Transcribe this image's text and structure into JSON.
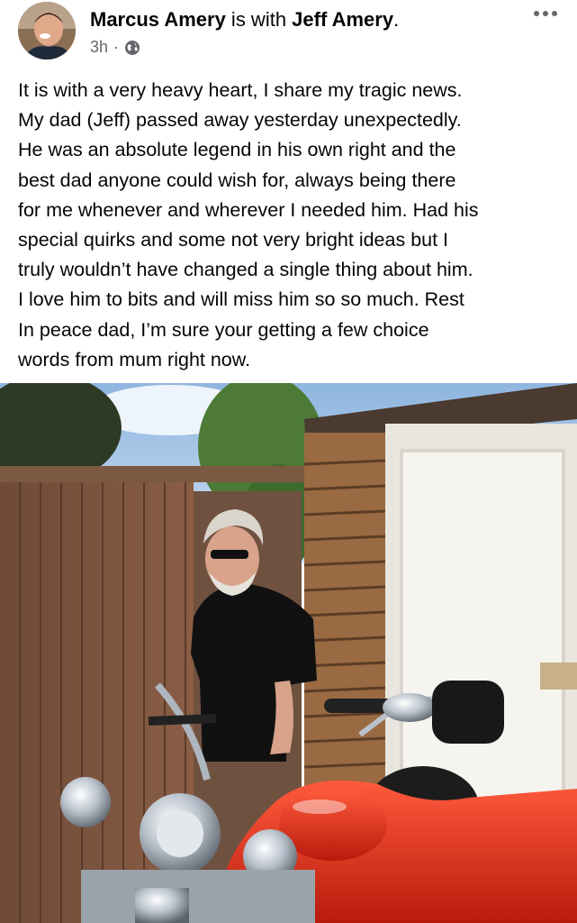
{
  "post": {
    "author": "Marcus Amery",
    "connector": " is with ",
    "tagged": "Jeff Amery",
    "tagged_suffix": ".",
    "time": "3h",
    "time_sep": "·",
    "audience_icon": "globe-icon",
    "more_icon": "more-options-icon",
    "text": "It is with a very heavy heart, I share my tragic news.\nMy dad (Jeff) passed away yesterday unexpectedly.\nHe was an absolute legend in his own right and the\nbest dad anyone could wish for, always being there\nfor me whenever and wherever I needed him. Had his\nspecial quirks and some not very bright ideas but I\ntruly wouldn’t have changed a single thing about him.\nI love him to bits and will miss him so so much. Rest\nIn peace dad, I’m sure your getting a few choice\nwords from mum right now."
  },
  "colors": {
    "text": "#050505",
    "secondary": "#65676b"
  }
}
